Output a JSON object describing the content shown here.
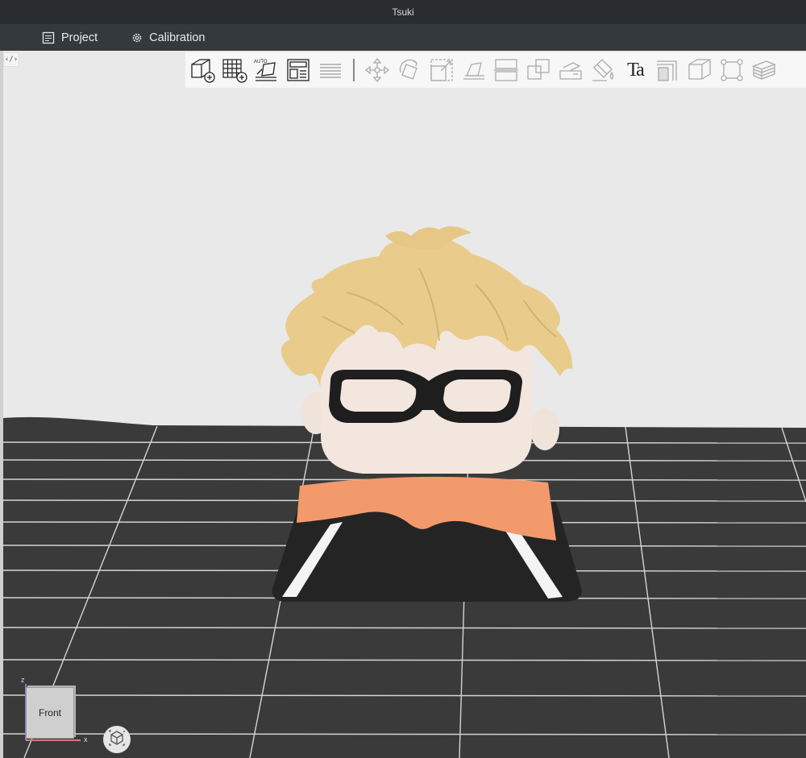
{
  "window": {
    "title": "Tsuki"
  },
  "menu": {
    "items": [
      {
        "label": "Project",
        "icon": "document-icon"
      },
      {
        "label": "Calibration",
        "icon": "gear-icon"
      }
    ]
  },
  "viewport": {
    "panel_toggle_label": "‹/›",
    "view_cube_label": "Front",
    "axis_z": "z",
    "axis_x": "x"
  },
  "toolbar": {
    "tools": [
      "add-model-icon",
      "grid-layout-icon",
      "auto-arrange-icon",
      "layout-icon",
      "slice-list-icon",
      "move-icon",
      "rotate-icon",
      "scale-icon",
      "lay-flat-icon",
      "cut-icon",
      "merge-icon",
      "place-face-icon",
      "paint-icon",
      "text-icon",
      "support-icon",
      "cube-icon",
      "bounding-box-icon",
      "layers-icon"
    ],
    "text_tool_label": "Ta"
  },
  "colors": {
    "hair": "#e9cc8c",
    "skin": "#f2e6df",
    "glasses": "#1e1e1e",
    "collar": "#f29a6c",
    "body": "#242424",
    "plate": "#3a3a3a",
    "grid_line": "#d9d9d9"
  }
}
